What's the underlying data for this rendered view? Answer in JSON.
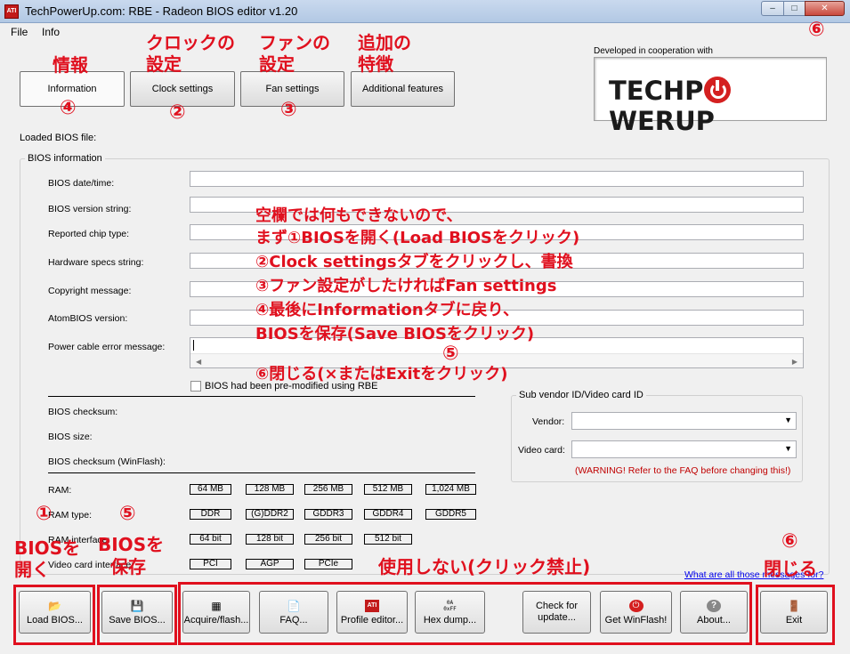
{
  "window": {
    "title": "TechPowerUp.com: RBE - Radeon BIOS editor v1.20",
    "app_icon": "ATI",
    "minimize": "–",
    "maximize": "□",
    "close": "✕"
  },
  "menu": {
    "file": "File",
    "info": "Info"
  },
  "tabs": {
    "information": "Information",
    "clock": "Clock settings",
    "fan": "Fan settings",
    "additional": "Additional features"
  },
  "logo": {
    "coop": "Developed in cooperation with",
    "part1": "TECHP",
    "part2": "WERUP"
  },
  "loaded_label": "Loaded BIOS file:",
  "bios_info": {
    "title": "BIOS information",
    "labels": [
      "BIOS date/time:",
      "BIOS version string:",
      "Reported chip type:",
      "Hardware specs string:",
      "Copyright message:",
      "AtomBIOS version:",
      "Power cable error message:"
    ],
    "premodified": "BIOS had been pre-modified using RBE",
    "checksum": "BIOS checksum:",
    "size": "BIOS size:",
    "checksum_winflash": "BIOS checksum (WinFlash):",
    "ram": "RAM:",
    "ram_type": "RAM type:",
    "ram_interface": "RAM interface:",
    "video_interface": "Video card interface:",
    "ram_sizes": [
      "64 MB",
      "128 MB",
      "256 MB",
      "512 MB",
      "1,024 MB"
    ],
    "ram_types": [
      "DDR",
      "(G)DDR2",
      "GDDR3",
      "GDDR4",
      "GDDR5"
    ],
    "ram_bits": [
      "64 bit",
      "128 bit",
      "256 bit",
      "512 bit"
    ],
    "interfaces": [
      "PCI",
      "AGP",
      "PCIe"
    ]
  },
  "subvendor": {
    "title": "Sub vendor ID/Video card ID",
    "vendor": "Vendor:",
    "video_card": "Video card:",
    "warning": "(WARNING! Refer to the FAQ before changing this!)"
  },
  "faq_link": "What are all those messages for?",
  "buttons": {
    "load": "Load BIOS...",
    "save": "Save BIOS...",
    "acquire": "Acquire/flash...",
    "faq": "FAQ...",
    "profile": "Profile editor...",
    "hexdump": "Hex dump...",
    "check_line1": "Check for",
    "check_line2": "update...",
    "winflash": "Get WinFlash!",
    "about": "About...",
    "exit": "Exit",
    "profile_icon_text": "ATI",
    "hex_icon_text": "0A\n0xFF"
  },
  "annotations": {
    "info_title": "情報",
    "info_num": "④",
    "clock_title1": "クロックの",
    "clock_title2": "設定",
    "clock_num": "②",
    "fan_title1": "ファンの",
    "fan_title2": "設定",
    "fan_num": "③",
    "add_title1": "追加の",
    "add_title2": "特徴",
    "close_num_top": "⑥",
    "instr_lines": [
      "空欄では何もできないので、",
      "まず①BIOSを開く(Load BIOSをクリック)",
      "②Clock settingsタブをクリックし、書換",
      "③ファン設定がしたければFan settings",
      "④最後にInformationタブに戻り、",
      "BIOSを保存(Save BIOSをクリック)"
    ],
    "instr_num5": "⑤",
    "instr_close": "⑥閉じる(×またはExitをクリック)",
    "load_num": "①",
    "load_text1": "BIOSを",
    "load_text2": "開く",
    "save_num": "⑤",
    "save_text1": "BIOSを",
    "save_text2": "保存",
    "unused": "使用しない(クリック禁止)",
    "exit_num": "⑥",
    "exit_text": "閉じる"
  }
}
